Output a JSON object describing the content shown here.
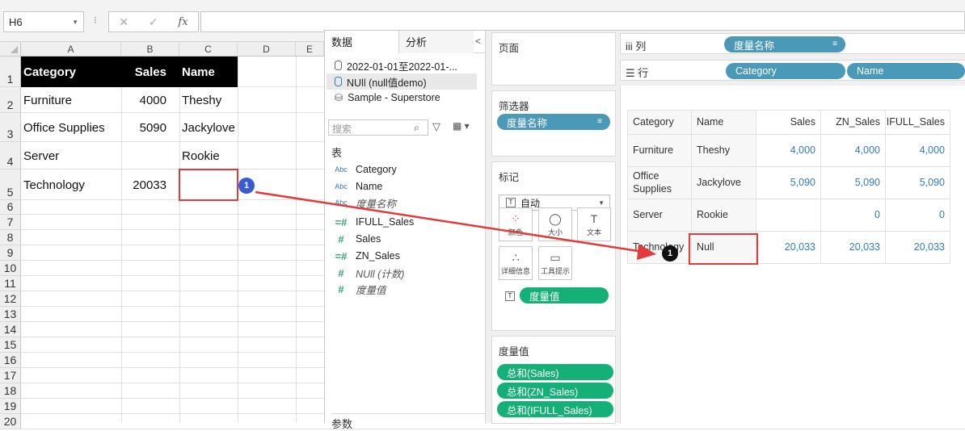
{
  "excel": {
    "name_box": "H6",
    "fx_label": "fx",
    "columns": [
      "A",
      "B",
      "C",
      "D",
      "E"
    ],
    "rows": [
      "1",
      "2",
      "3",
      "4",
      "5",
      "6",
      "7",
      "8",
      "9",
      "10",
      "11",
      "12",
      "13",
      "14",
      "15",
      "16",
      "17",
      "18",
      "19",
      "20"
    ],
    "header": {
      "category": "Category",
      "sales": "Sales",
      "name": "Name"
    },
    "data": [
      {
        "category": "Furniture",
        "sales": "4000",
        "name": "Theshy"
      },
      {
        "category": "Office Supplies",
        "sales": "5090",
        "name": "Jackylove"
      },
      {
        "category": "Server",
        "sales": "",
        "name": "Rookie"
      },
      {
        "category": "Technology",
        "sales": "20033",
        "name": ""
      }
    ],
    "badge": "1"
  },
  "tableau": {
    "tabs": {
      "data": "数据",
      "analysis": "分析"
    },
    "sources": [
      {
        "label": "2022-01-01至2022-01-..."
      },
      {
        "label": "NUll (null值demo)"
      },
      {
        "label": "Sample - Superstore"
      }
    ],
    "search_placeholder": "搜索",
    "tables_label": "表",
    "dimensions": [
      {
        "type": "Abc",
        "label": "Category"
      },
      {
        "type": "Abc",
        "label": "Name"
      },
      {
        "type": "Abc",
        "label": "度量名称"
      }
    ],
    "measures": [
      {
        "type": "=#",
        "label": "IFULL_Sales"
      },
      {
        "type": "#",
        "label": "Sales"
      },
      {
        "type": "=#",
        "label": "ZN_Sales"
      },
      {
        "type": "#",
        "label": "NUll (计数)"
      },
      {
        "type": "#",
        "label": "度量值"
      }
    ],
    "params_label": "参数",
    "pages_label": "页面",
    "filters_label": "筛选器",
    "filter_pill": "度量名称",
    "marks_label": "标记",
    "marks_type": "自动",
    "mark_buttons": [
      "颜色",
      "大小",
      "文本",
      "详细信息",
      "工具提示"
    ],
    "marks_pill": "度量值",
    "mv_label": "度量值",
    "mv_pills": [
      "总和(Sales)",
      "总和(ZN_Sales)",
      "总和(IFULL_Sales)"
    ],
    "columns_shelf": {
      "label": "列",
      "pills": [
        "度量名称"
      ]
    },
    "rows_shelf": {
      "label": "行",
      "pills": [
        "Category",
        "Name"
      ]
    },
    "table": {
      "headers": [
        "Category",
        "Name",
        "Sales",
        "ZN_Sales",
        "IFULL_Sales"
      ],
      "rows": [
        {
          "category": "Furniture",
          "name": "Theshy",
          "sales": "4,000",
          "zn": "4,000",
          "ifull": "4,000"
        },
        {
          "category": "Office Supplies",
          "name": "Jackylove",
          "sales": "5,090",
          "zn": "5,090",
          "ifull": "5,090"
        },
        {
          "category": "Server",
          "name": "Rookie",
          "sales": "",
          "zn": "0",
          "ifull": "0"
        },
        {
          "category": "Technology",
          "name": "Null",
          "sales": "20,033",
          "zn": "20,033",
          "ifull": "20,033"
        }
      ]
    },
    "badge": "1"
  },
  "colors": {
    "accent_red": "#e23b3b",
    "pill_blue": "#4b99b8",
    "pill_green": "#15b077",
    "badge_blue": "#3a5bd6"
  }
}
